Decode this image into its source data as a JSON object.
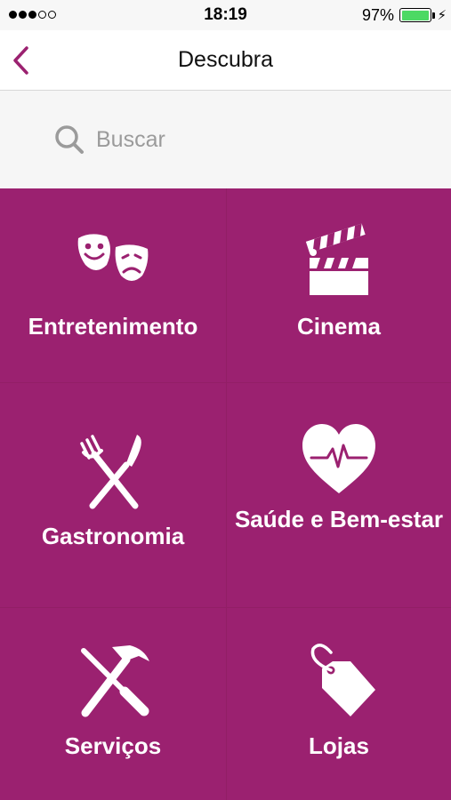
{
  "status_bar": {
    "signal_dots_filled": 3,
    "signal_dots_total": 5,
    "time": "18:19",
    "battery_percent": "97%",
    "battery_level": 0.97,
    "battery_color": "#4cd964"
  },
  "nav": {
    "back_icon": "chevron-left-icon",
    "title": "Descubra",
    "accent_color": "#9b2170"
  },
  "search": {
    "icon": "search-icon",
    "placeholder": "Buscar"
  },
  "categories": [
    {
      "label": "Entretenimento",
      "icon": "theater-masks-icon"
    },
    {
      "label": "Cinema",
      "icon": "clapperboard-icon"
    },
    {
      "label": "Gastronomia",
      "icon": "fork-knife-icon"
    },
    {
      "label": "Saúde e Bem-estar",
      "icon": "heart-pulse-icon"
    },
    {
      "label": "Serviços",
      "icon": "tools-icon"
    },
    {
      "label": "Lojas",
      "icon": "price-tag-icon"
    }
  ],
  "colors": {
    "tile_background": "#9b2170",
    "tile_divider": "#921f66",
    "tile_text": "#ffffff"
  }
}
